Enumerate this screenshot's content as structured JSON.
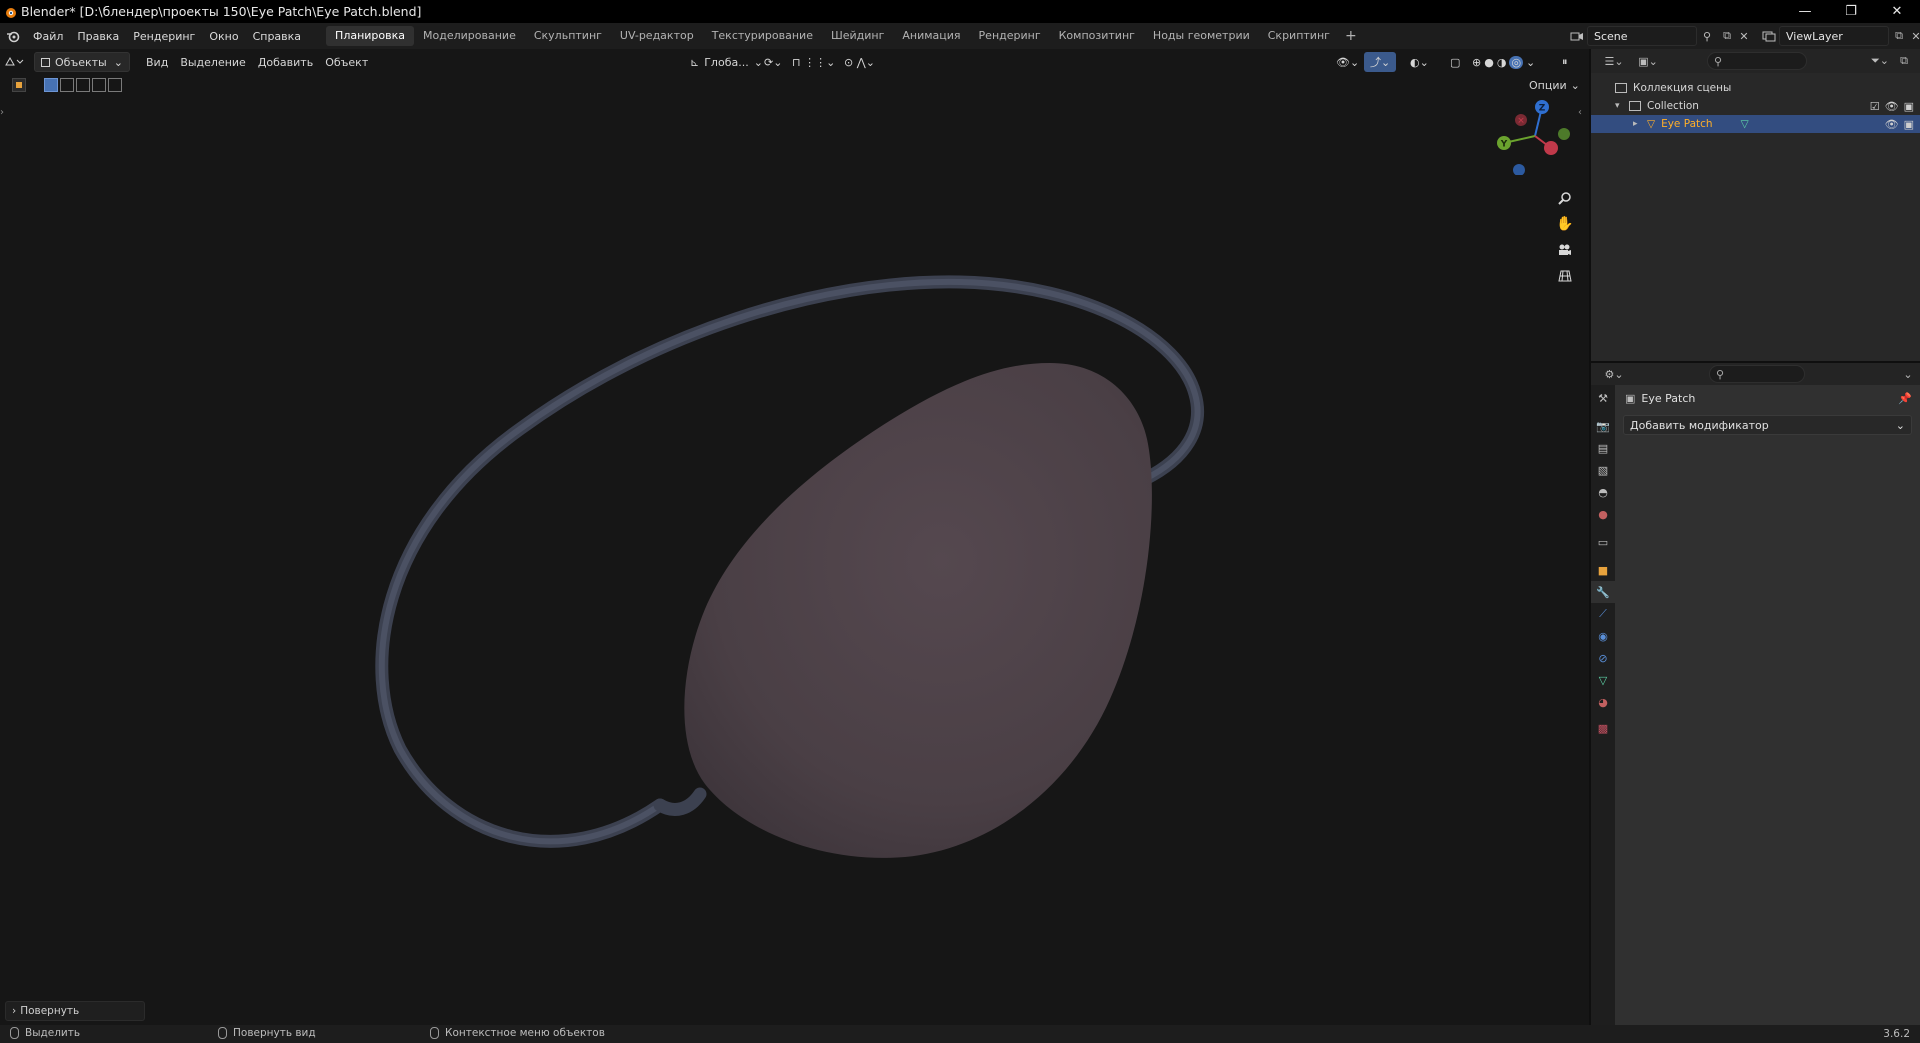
{
  "window": {
    "title": "Blender* [D:\\блендер\\проекты 150\\Eye Patch\\Eye Patch.blend]",
    "minimize": "—",
    "maximize": "❐",
    "close": "✕"
  },
  "menu": [
    "Файл",
    "Правка",
    "Рендеринг",
    "Окно",
    "Справка"
  ],
  "workspaces": {
    "tabs": [
      "Планировка",
      "Моделирование",
      "Скульптинг",
      "UV-редактор",
      "Текстурирование",
      "Шейдинг",
      "Анимация",
      "Рендеринг",
      "Композитинг",
      "Ноды геометрии",
      "Скриптинг"
    ],
    "active": "Планировка",
    "add": "+"
  },
  "scene": {
    "name": "Scene",
    "view_layer": "ViewLayer"
  },
  "viewport": {
    "mode": "Объекты",
    "menus": [
      "Вид",
      "Выделение",
      "Добавить",
      "Объект"
    ],
    "orientation": "Глоба...",
    "options": "Опции",
    "gizmo": {
      "z": "Z",
      "y": "Y",
      "x": "X"
    },
    "last_operator": "Повернуть"
  },
  "outliner": {
    "rows": [
      {
        "label": "Коллекция сцены",
        "depth": 0
      },
      {
        "label": "Collection",
        "depth": 1
      },
      {
        "label": "Eye Patch",
        "depth": 2,
        "selected": true
      }
    ]
  },
  "properties": {
    "object_name": "Eye Patch",
    "add_modifier": "Добавить модификатор",
    "tab_icons": [
      "tool-icon",
      "render-icon",
      "output-icon",
      "view-layer-icon",
      "scene-icon",
      "world-icon",
      "collection-icon",
      "object-icon",
      "modifier-icon",
      "particles-icon",
      "physics-icon",
      "constraints-icon",
      "data-icon",
      "material-icon",
      "texture-icon"
    ],
    "active_tab": "modifier-icon"
  },
  "statusbar": {
    "select": "Выделить",
    "rotate_view": "Повернуть вид",
    "context_menu": "Контекстное меню объектов",
    "version": "3.6.2"
  },
  "colors": {
    "accent": "#4772b3",
    "selected_row": "#334d80",
    "object_highlight": "#ffaf29",
    "mesh_data": "#5fd4a8"
  }
}
